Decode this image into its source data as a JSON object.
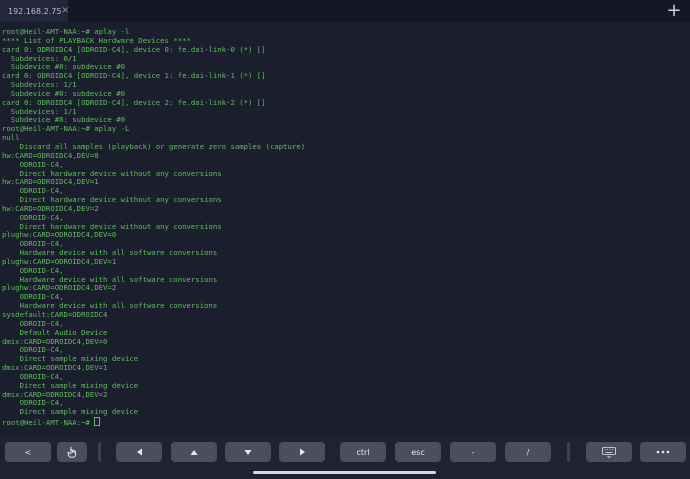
{
  "tab": {
    "title": "192.168.2.75",
    "close": "✕"
  },
  "new_tab": "+",
  "terminal": {
    "lines": [
      "root@Heil-AMT-NAA:~# aplay -l",
      "**** List of PLAYBACK Hardware Devices ****",
      "card 0: ODROIDC4 [ODROID-C4], device 0: fe.dai-link-0 (*) []",
      "  Subdevices: 0/1",
      "  Subdevice #0: subdevice #0",
      "card 0: ODROIDC4 [ODROID-C4], device 1: fe.dai-link-1 (*) []",
      "  Subdevices: 1/1",
      "  Subdevice #0: subdevice #0",
      "card 0: ODROIDC4 [ODROID-C4], device 2: fe.dai-link-2 (*) []",
      "  Subdevices: 1/1",
      "  Subdevice #0: subdevice #0",
      "root@Heil-AMT-NAA:~# aplay -L",
      "null",
      "    Discard all samples (playback) or generate zero samples (capture)",
      "hw:CARD=ODROIDC4,DEV=0",
      "    ODROID-C4,",
      "    Direct hardware device without any conversions",
      "hw:CARD=ODROIDC4,DEV=1",
      "    ODROID-C4,",
      "    Direct hardware device without any conversions",
      "hw:CARD=ODROIDC4,DEV=2",
      "    ODROID-C4,",
      "    Direct hardware device without any conversions",
      "plughw:CARD=ODROIDC4,DEV=0",
      "    ODROID-C4,",
      "    Hardware device with all software conversions",
      "plughw:CARD=ODROIDC4,DEV=1",
      "    ODROID-C4,",
      "    Hardware device with all software conversions",
      "plughw:CARD=ODROIDC4,DEV=2",
      "    ODROID-C4,",
      "    Hardware device with all software conversions",
      "sysdefault:CARD=ODROIDC4",
      "    ODROID-C4,",
      "    Default Audio Device",
      "dmix:CARD=ODROIDC4,DEV=0",
      "    ODROID-C4,",
      "    Direct sample mixing device",
      "dmix:CARD=ODROIDC4,DEV=1",
      "    ODROID-C4,",
      "    Direct sample mixing device",
      "dmix:CARD=ODROIDC4,DEV=2",
      "    ODROID-C4,",
      "    Direct sample mixing device"
    ],
    "prompt": "root@Heil-AMT-NAA:~# "
  },
  "keys": {
    "back": "<",
    "ctrl": "ctrl",
    "esc": "esc",
    "minus": "-",
    "slash": "/"
  },
  "colors": {
    "background": "#1b1e2c",
    "terminal_text": "#5fbe5f",
    "key": "#4a4f5f"
  }
}
